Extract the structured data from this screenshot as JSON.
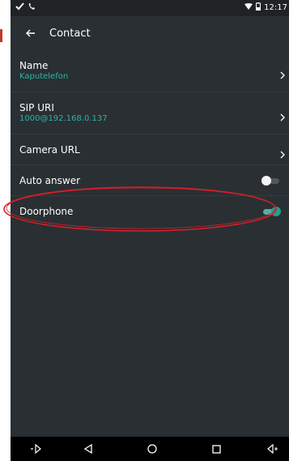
{
  "status_bar": {
    "time": "12:17"
  },
  "toolbar": {
    "title": "Contact"
  },
  "rows": {
    "name": {
      "title": "Name",
      "value": "Kaputelefon"
    },
    "sip_uri": {
      "title": "SIP URI",
      "value": "1000@192.168.0.137"
    },
    "camera_url": {
      "title": "Camera URL"
    },
    "auto_answer": {
      "title": "Auto answer",
      "enabled": false
    },
    "doorphone": {
      "title": "Doorphone",
      "enabled": true
    }
  },
  "colors": {
    "accent": "#22a08f",
    "subtitle": "#2bb5a3",
    "background": "#2a2f33",
    "highlight": "#d0202a"
  },
  "icons": {
    "back": "arrow-left-icon",
    "chevron": "chevron-right-icon",
    "nav": [
      "volume-down-icon",
      "back-triangle-icon",
      "home-circle-icon",
      "recents-square-icon",
      "volume-up-icon"
    ]
  }
}
